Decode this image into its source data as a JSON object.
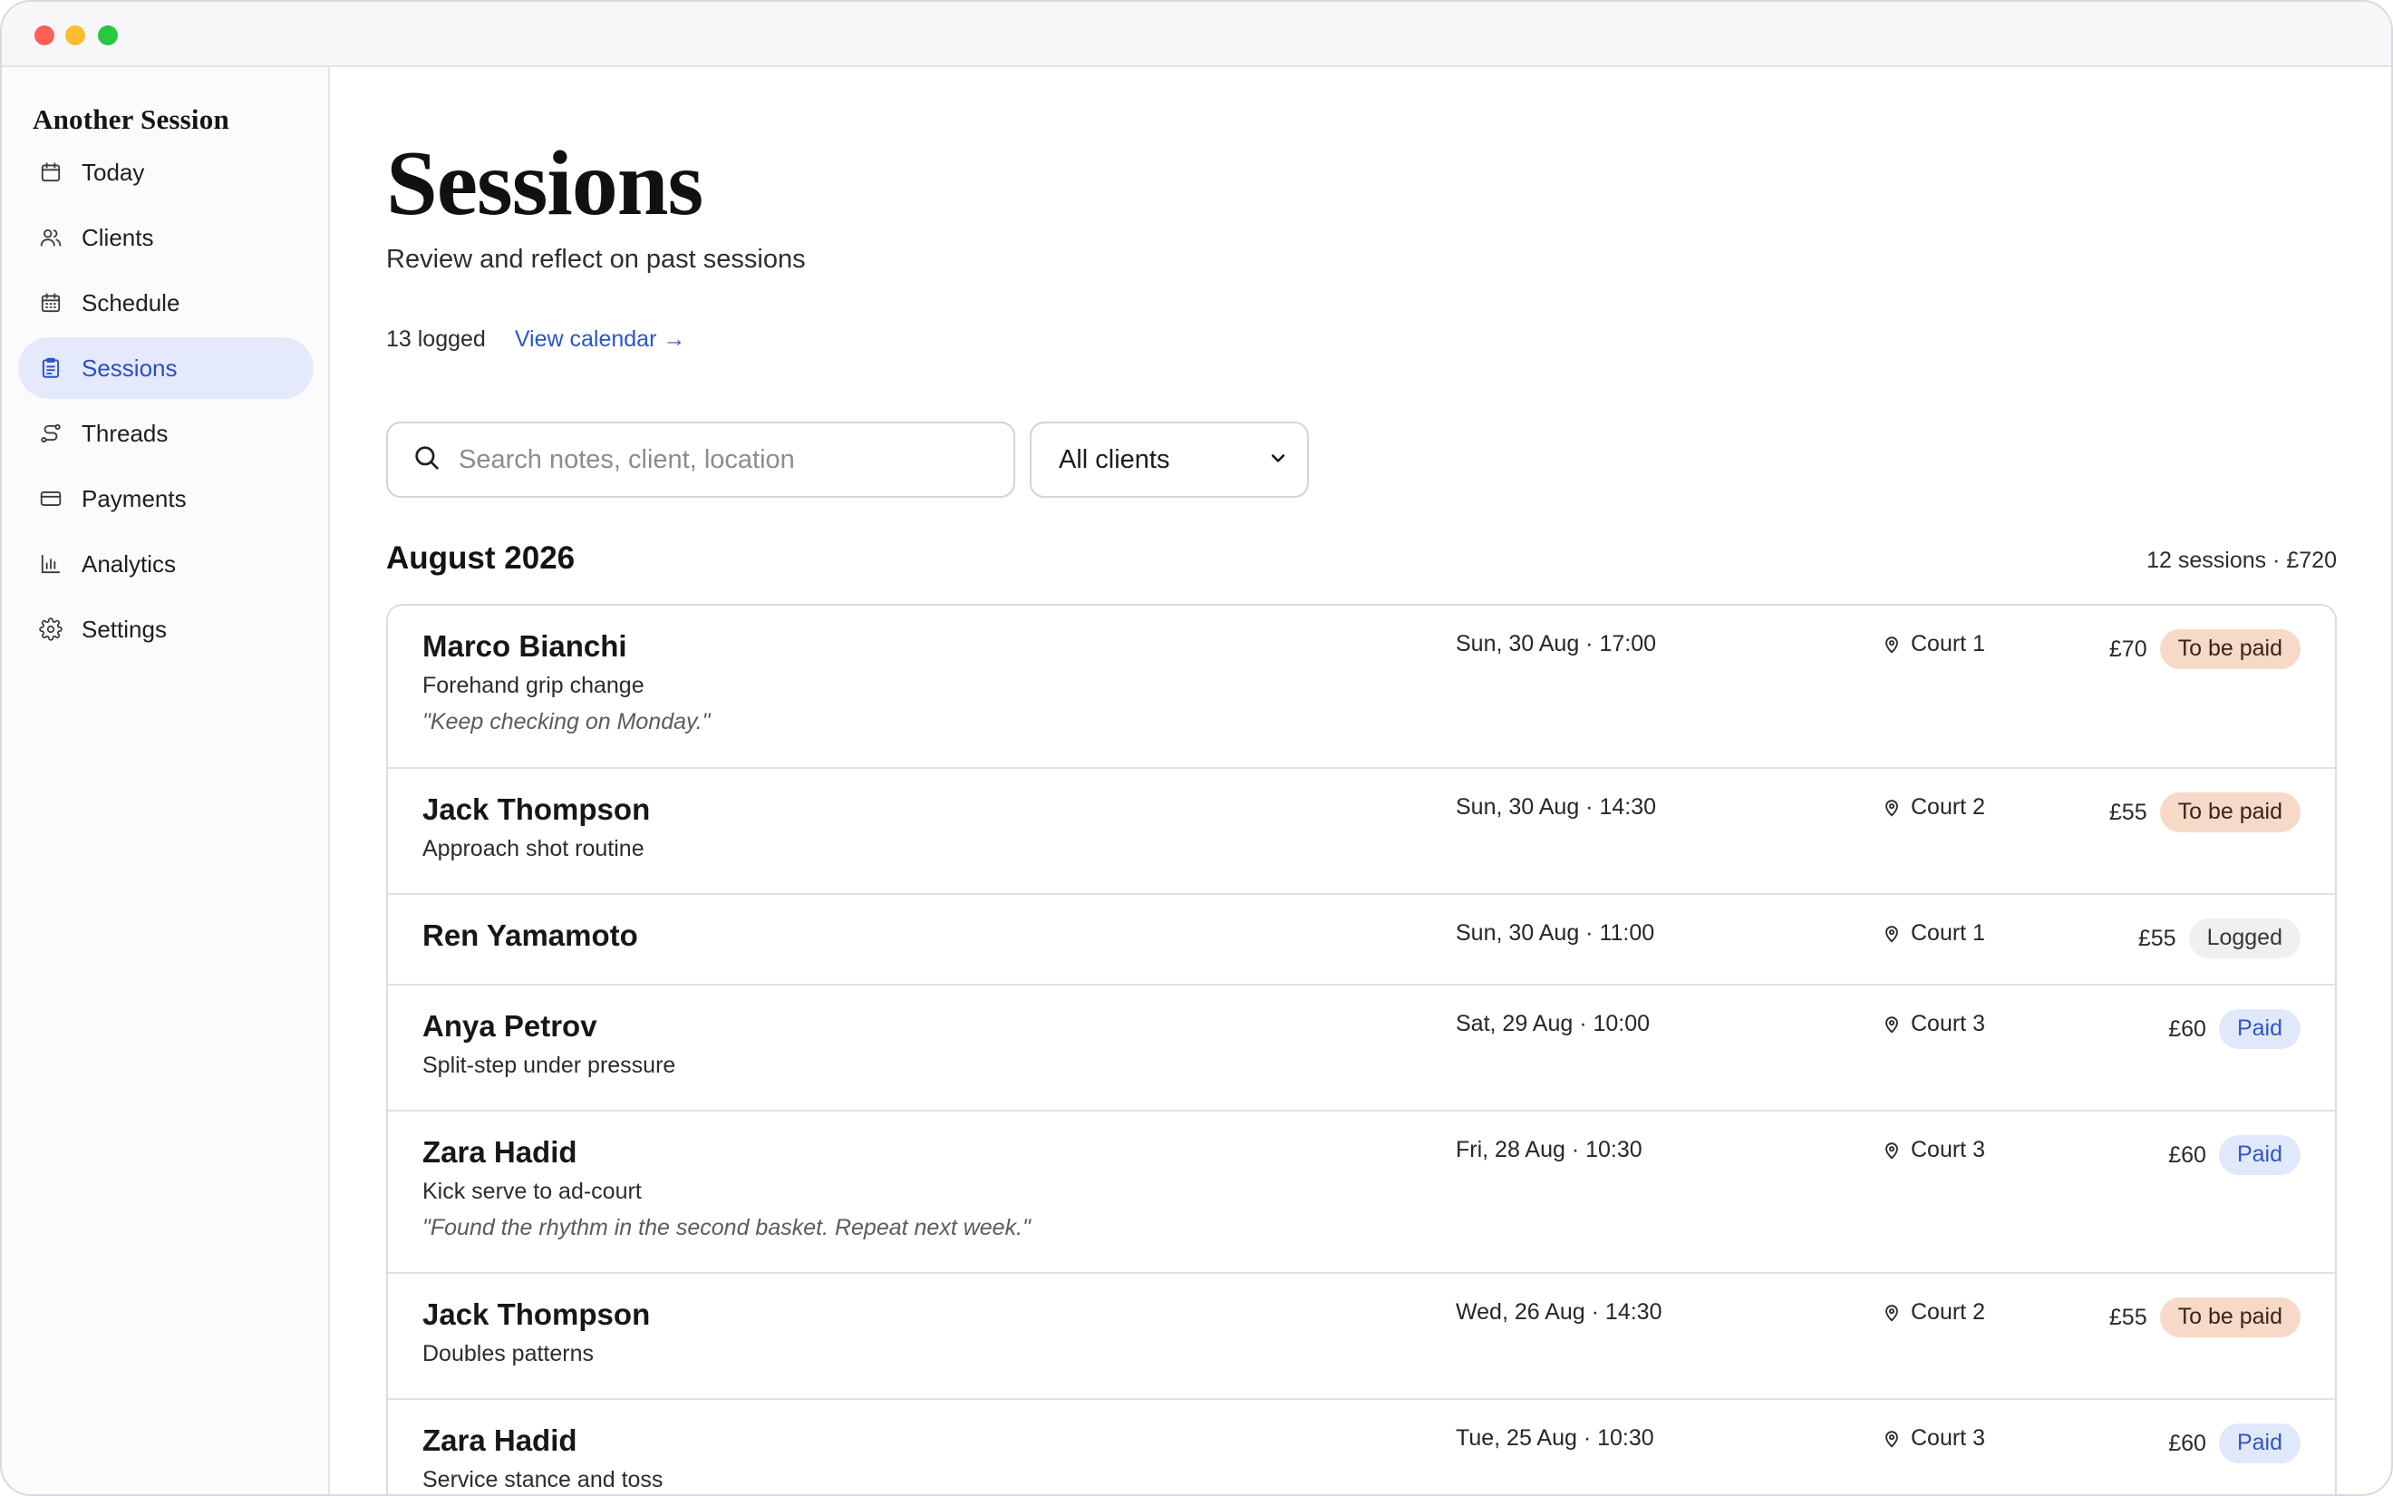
{
  "app": {
    "brand": "Another Session"
  },
  "sidebar": {
    "items": [
      {
        "label": "Today",
        "icon": "calendar-day-icon",
        "active": false
      },
      {
        "label": "Clients",
        "icon": "users-icon",
        "active": false
      },
      {
        "label": "Schedule",
        "icon": "calendar-grid-icon",
        "active": false
      },
      {
        "label": "Sessions",
        "icon": "clipboard-list-icon",
        "active": true
      },
      {
        "label": "Threads",
        "icon": "route-icon",
        "active": false
      },
      {
        "label": "Payments",
        "icon": "credit-card-icon",
        "active": false
      },
      {
        "label": "Analytics",
        "icon": "bar-chart-icon",
        "active": false
      },
      {
        "label": "Settings",
        "icon": "gear-icon",
        "active": false
      }
    ]
  },
  "page": {
    "title": "Sessions",
    "subtitle": "Review and reflect on past sessions",
    "logged_count": "13 logged",
    "calendar_link": "View calendar →"
  },
  "filters": {
    "search_placeholder": "Search notes, client, location",
    "search_value": "",
    "client_select_value": "All clients"
  },
  "month": {
    "title": "August 2026",
    "summary": "12 sessions · £720"
  },
  "colors": {
    "accent": "#2c55c8",
    "active_nav_bg": "#e4e9fb",
    "status_due_bg": "#f7d9c8",
    "status_paid_bg": "#e2e8fb",
    "status_logged_bg": "#f0f0f2"
  },
  "sessions": [
    {
      "client": "Marco Bianchi",
      "focus": "Forehand grip change",
      "note": "\"Keep checking on Monday.\"",
      "when": "Sun, 30 Aug · 17:00",
      "where": "Court 1",
      "price": "£70",
      "status": "To be paid",
      "status_kind": "due"
    },
    {
      "client": "Jack Thompson",
      "focus": "Approach shot routine",
      "note": "",
      "when": "Sun, 30 Aug · 14:30",
      "where": "Court 2",
      "price": "£55",
      "status": "To be paid",
      "status_kind": "due"
    },
    {
      "client": "Ren Yamamoto",
      "focus": "",
      "note": "",
      "when": "Sun, 30 Aug · 11:00",
      "where": "Court 1",
      "price": "£55",
      "status": "Logged",
      "status_kind": "logged"
    },
    {
      "client": "Anya Petrov",
      "focus": "Split-step under pressure",
      "note": "",
      "when": "Sat, 29 Aug · 10:00",
      "where": "Court 3",
      "price": "£60",
      "status": "Paid",
      "status_kind": "paid"
    },
    {
      "client": "Zara Hadid",
      "focus": "Kick serve to ad-court",
      "note": "\"Found the rhythm in the second basket. Repeat next week.\"",
      "when": "Fri, 28 Aug · 10:30",
      "where": "Court 3",
      "price": "£60",
      "status": "Paid",
      "status_kind": "paid"
    },
    {
      "client": "Jack Thompson",
      "focus": "Doubles patterns",
      "note": "",
      "when": "Wed, 26 Aug · 14:30",
      "where": "Court 2",
      "price": "£55",
      "status": "To be paid",
      "status_kind": "due"
    },
    {
      "client": "Zara Hadid",
      "focus": "Service stance and toss",
      "note": "",
      "when": "Tue, 25 Aug · 10:30",
      "where": "Court 3",
      "price": "£60",
      "status": "Paid",
      "status_kind": "paid"
    }
  ]
}
